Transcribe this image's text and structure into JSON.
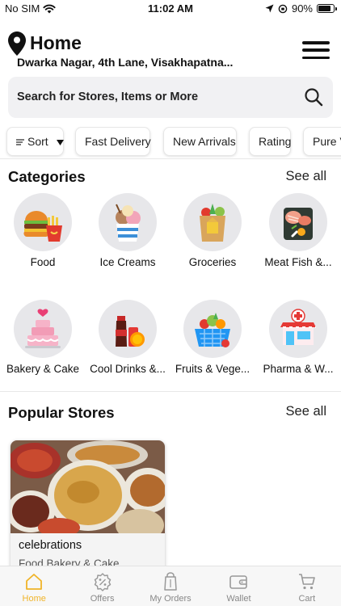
{
  "status_bar": {
    "carrier": "No SIM",
    "time": "11:02 AM",
    "battery": "90%",
    "battery_level": 0.9
  },
  "header": {
    "title": "Home",
    "address": "Dwarka Nagar, 4th Lane, Visakhapatna..."
  },
  "search": {
    "placeholder": "Search for Stores, Items or More"
  },
  "filters": [
    {
      "label": "Sort"
    },
    {
      "label": "Fast Delivery"
    },
    {
      "label": "New Arrivals"
    },
    {
      "label": "Rating"
    },
    {
      "label": "Pure V"
    }
  ],
  "categories": {
    "title": "Categories",
    "see_all": "See all",
    "items": [
      {
        "label": "Food",
        "icon": "food-icon"
      },
      {
        "label": "Ice Creams",
        "icon": "ice-cream-icon"
      },
      {
        "label": "Groceries",
        "icon": "groceries-icon"
      },
      {
        "label": "Meat Fish &...",
        "icon": "meat-fish-icon"
      },
      {
        "label": "Bakery & Cake",
        "icon": "cake-icon"
      },
      {
        "label": "Cool Drinks &...",
        "icon": "cool-drinks-icon"
      },
      {
        "label": "Fruits & Vege...",
        "icon": "fruit-basket-icon"
      },
      {
        "label": "Pharma & W...",
        "icon": "pharmacy-icon"
      }
    ]
  },
  "popular_stores": {
    "title": "Popular Stores",
    "see_all": "See all",
    "stores": [
      {
        "name": "celebrations",
        "category": "Food,Bakery & Cake"
      }
    ]
  },
  "tabbar": [
    {
      "label": "Home",
      "icon": "home-icon",
      "active": true
    },
    {
      "label": "Offers",
      "icon": "offers-icon",
      "active": false
    },
    {
      "label": "My Orders",
      "icon": "orders-icon",
      "active": false
    },
    {
      "label": "Wallet",
      "icon": "wallet-icon",
      "active": false
    },
    {
      "label": "Cart",
      "icon": "cart-icon",
      "active": false
    }
  ],
  "colors": {
    "accent": "#f0b429",
    "search_bg": "#f1f1f3",
    "category_circle": "#e7e7ea"
  }
}
